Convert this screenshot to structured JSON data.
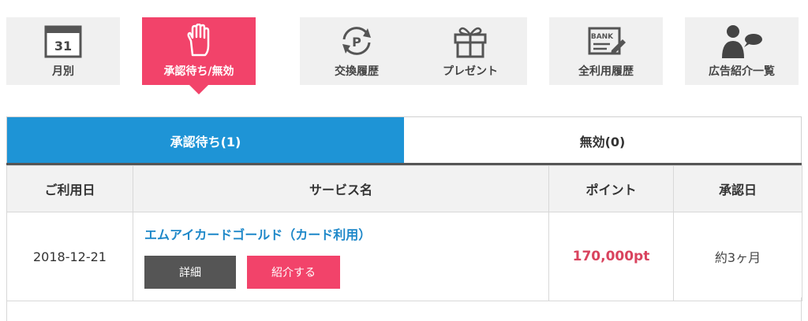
{
  "nav": {
    "items": [
      {
        "label": "月別",
        "icon": "calendar-icon",
        "calendar_day": "31"
      },
      {
        "label": "承認待ち/無効",
        "icon": "hand-icon"
      },
      {
        "label": "交換履歴",
        "icon": "point-exchange-icon",
        "icon_letter": "P"
      },
      {
        "label": "プレゼント",
        "icon": "gift-icon"
      },
      {
        "label": "全利用履歴",
        "icon": "bank-book-icon",
        "icon_text": "BANK"
      },
      {
        "label": "広告紹介一覧",
        "icon": "person-speech-icon"
      }
    ],
    "active_color": "#f2436a"
  },
  "tabs": [
    {
      "label": "承認待ち(1)",
      "active": true
    },
    {
      "label": "無効(0)",
      "active": false
    }
  ],
  "table": {
    "headers": [
      "ご利用日",
      "サービス名",
      "ポイント",
      "承認日"
    ],
    "rows": [
      {
        "date": "2018-12-21",
        "service": "エムアイカードゴールド（カード利用）",
        "detail_label": "詳細",
        "intro_label": "紹介する",
        "points": "170,000pt",
        "approval": "約3ヶ月"
      }
    ]
  },
  "colors": {
    "tab_active": "#1e94d6",
    "link": "#1e88c9",
    "points": "#d9435e"
  }
}
